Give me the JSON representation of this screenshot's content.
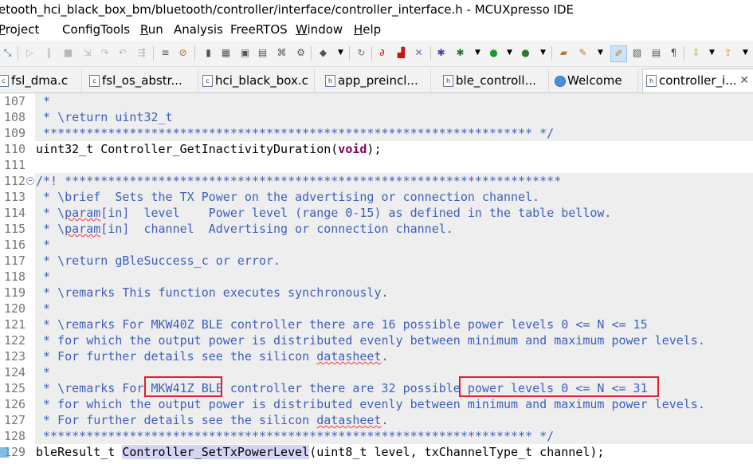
{
  "window": {
    "title": "etooth_hci_black_box_bm/bluetooth/controller/interface/controller_interface.h - MCUXpresso IDE"
  },
  "menu": [
    {
      "label": "Project",
      "mnemonic": "P"
    },
    {
      "label": "ConfigTools"
    },
    {
      "label": "Run",
      "mnemonic": "R"
    },
    {
      "label": "Analysis"
    },
    {
      "label": "FreeRTOS"
    },
    {
      "label": "Window",
      "mnemonic": "W"
    },
    {
      "label": "Help",
      "mnemonic": "H"
    }
  ],
  "toolbar_icons": [
    "pin-icon",
    "step-over-icon",
    "suspend-icon",
    "terminate-icon",
    "step-into-icon",
    "step-return-icon",
    "drop-frame-icon",
    "disconnect-icon",
    "console-icon",
    "skip-breakpoints-icon",
    "memory-icon",
    "registers-icon",
    "variables-icon",
    "expressions-icon",
    "trace-icon",
    "settings-icon",
    "chip-icon",
    "dropdown-icon",
    "reset-icon",
    "link-icon",
    "boot-icon",
    "flash-icon",
    "debug-bug-icon",
    "debug-config-icon",
    "dropdown-icon",
    "run-icon",
    "dropdown-icon",
    "external-tools-icon",
    "dropdown-icon",
    "open-task-icon",
    "search-icon",
    "dropdown-icon",
    "mark-occurrences-icon",
    "toggle-word-wrap-icon",
    "block-selection-icon",
    "show-whitespace-icon",
    "next-annotation-icon",
    "dropdown-icon",
    "previous-annotation-icon",
    "dropdown-icon"
  ],
  "tabs": [
    {
      "label": "fsl_dma.c",
      "icon": "c"
    },
    {
      "label": "fsl_os_abstr...",
      "icon": "c"
    },
    {
      "label": "hci_black_box.c",
      "icon": "c"
    },
    {
      "label": "app_preincl...",
      "icon": "h"
    },
    {
      "label": "ble_controll...",
      "icon": "h"
    },
    {
      "label": "Welcome",
      "icon": "globe-icon"
    },
    {
      "label": "controller_i...",
      "icon": "h",
      "active": true,
      "close": "✕"
    }
  ],
  "editor": {
    "lines": [
      {
        "num": "107",
        "text": " *"
      },
      {
        "num": "108",
        "text": " * \\return uint32_t"
      },
      {
        "num": "109",
        "text": " ******************************************************************** */"
      },
      {
        "num": "110",
        "pre": "uint32_t Controller_GetInactivityDuration(",
        "kw": "void",
        "post": ");"
      },
      {
        "num": "111",
        "text": ""
      },
      {
        "num": "112",
        "text": "/*! *********************************************************************"
      },
      {
        "num": "113",
        "text": " * \\brief  Sets the TX Power on the advertising or connection channel."
      },
      {
        "num": "114",
        "pre": " * \\",
        "sq": "param",
        "post": "[in]  level    Power level (range 0-15) as defined in the table bellow."
      },
      {
        "num": "115",
        "pre": " * \\",
        "sq": "param",
        "post": "[in]  channel  Advertising or connection channel."
      },
      {
        "num": "116",
        "text": " *"
      },
      {
        "num": "117",
        "text": " * \\return gBleSuccess_c or error."
      },
      {
        "num": "118",
        "text": " *"
      },
      {
        "num": "119",
        "text": " * \\remarks This function executes synchronously."
      },
      {
        "num": "120",
        "text": " *"
      },
      {
        "num": "121",
        "text": " * \\remarks For MKW40Z BLE controller there are 16 possible power levels 0 <= N <= 15"
      },
      {
        "num": "122",
        "text": " * for which the output power is distributed evenly between minimum and maximum power levels."
      },
      {
        "num": "123",
        "pre": " * For further details see the silicon ",
        "sq": "datasheet",
        "post": "."
      },
      {
        "num": "124",
        "text": " *"
      },
      {
        "num": "125",
        "text": " * \\remarks For MKW41Z BLE controller there are 32 possible power levels 0 <= N <= 31"
      },
      {
        "num": "126",
        "text": " * for which the output power is distributed evenly between minimum and maximum power levels."
      },
      {
        "num": "127",
        "pre": " * For further details see the silicon ",
        "sq": "datasheet",
        "post": "."
      },
      {
        "num": "128",
        "text": " ******************************************************************** */"
      },
      {
        "num": "129",
        "pre": "bleResult_t ",
        "hl": "Controller_SetTxPowerLevel",
        "post": "(uint8_t level, txChannelType_t channel);"
      }
    ]
  },
  "annotations": [
    {
      "label": "mkw41z-ble-highlight",
      "color": "#e0202a"
    },
    {
      "label": "power-levels-highlight",
      "color": "#e0202a"
    }
  ]
}
